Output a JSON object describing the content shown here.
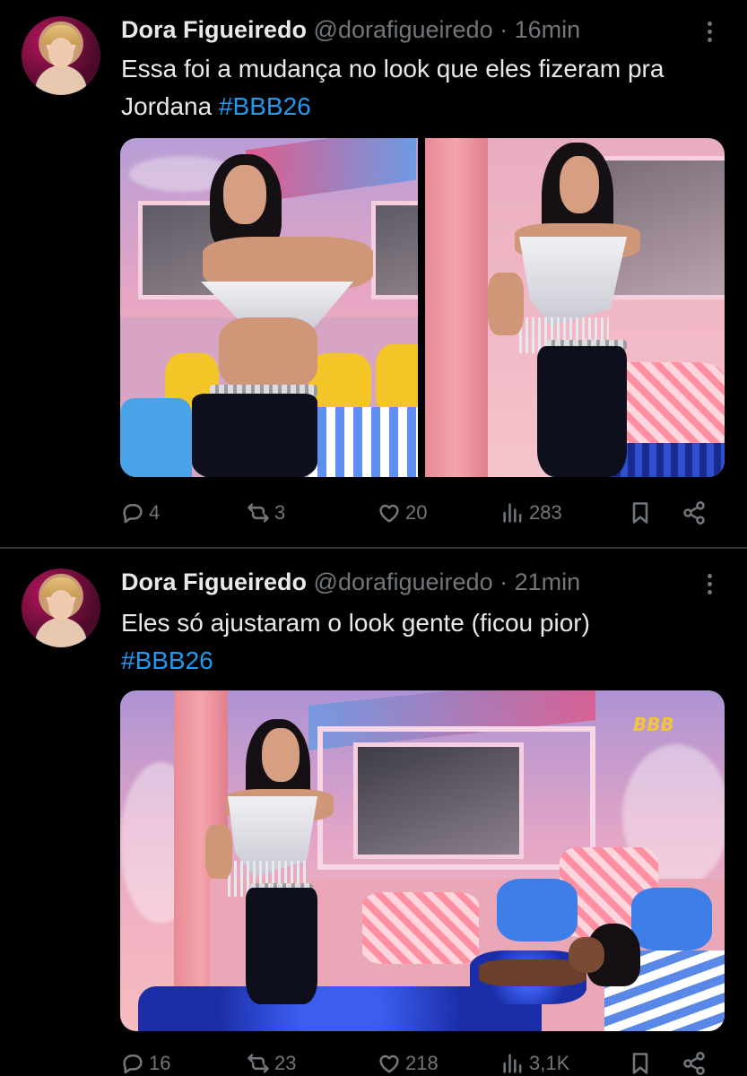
{
  "tweets": [
    {
      "author_name": "Dora Figueiredo",
      "handle": "@dorafigueiredo",
      "separator": "·",
      "time": "16min",
      "text_main": "Essa foi a mudança no look que eles fizeram pra Jordana ",
      "hashtag": "#BBB26",
      "replies": "4",
      "reposts": "3",
      "likes": "20",
      "views": "283"
    },
    {
      "author_name": "Dora Figueiredo",
      "handle": "@dorafigueiredo",
      "separator": "·",
      "time": "21min",
      "text_main": "Eles só ajustaram o look gente (ficou pior)",
      "hashtag": "#BBB26",
      "replies": "16",
      "reposts": "23",
      "likes": "218",
      "views": "3,1K",
      "media_logo": "BBB"
    }
  ],
  "icons": {
    "reply": "reply-icon",
    "repost": "repost-icon",
    "like": "heart-icon",
    "views": "views-icon",
    "bookmark": "bookmark-icon",
    "share": "share-icon",
    "more": "more-icon"
  },
  "colors": {
    "background": "#000000",
    "text": "#e7e9ea",
    "secondary": "#71767b",
    "link": "#1d9bf0",
    "divider": "#2f3336"
  }
}
